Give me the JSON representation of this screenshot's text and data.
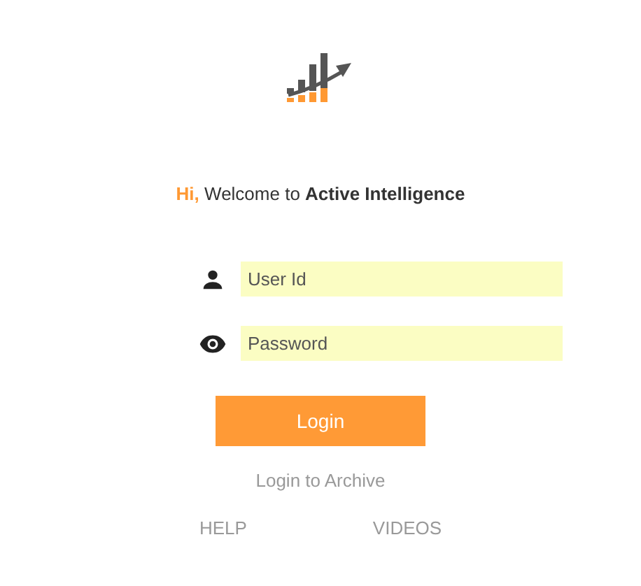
{
  "welcome": "**Hi,** Welcome to **Active Intelligence**",
  "fields": [
    {
      "kind": "user",
      "placeholder": "User Id"
    },
    {
      "kind": "password",
      "placeholder": "Password"
    }
  ],
  "login_button": "Login",
  "archive_link": "Login to Archive",
  "links": [
    "HELP",
    "VIDEOS"
  ]
}
